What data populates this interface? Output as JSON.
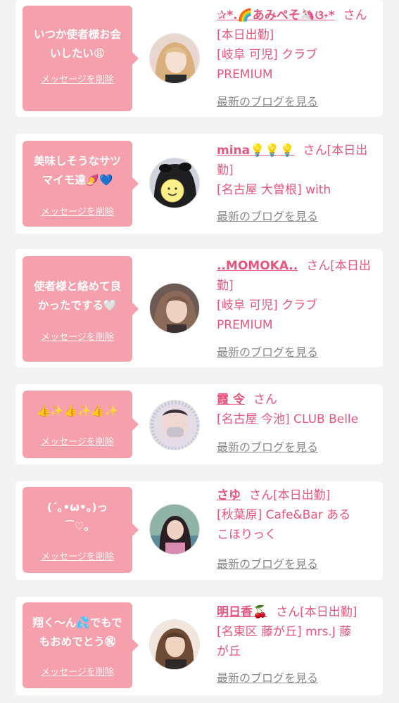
{
  "delete_label": "メッセージを削除",
  "blog_label": "最新のブログを見る",
  "colors": {
    "bubble": "#f7a0ad",
    "name": "#e8557e",
    "link_gray": "#8a8a8a",
    "background": "#f3f3f3"
  },
  "cards": [
    {
      "message": "いつか使者様お会\nいしたい😩",
      "avatar_icon": "cast-photo-1",
      "name": "✰*.🌈あみぺそ🦄ଓ˖*",
      "name_suffix": "さん[本日出勤]",
      "details": [
        "[岐阜 可児] クラブ",
        "PREMIUM"
      ]
    },
    {
      "message": "美味しそうなサツ\nマイモ達🍠💙",
      "avatar_icon": "cast-photo-2",
      "name": "mina💡💡💡",
      "name_suffix": "さん[本日出勤]",
      "details": [
        "[名古屋 大曽根] with"
      ]
    },
    {
      "message": "使者様と絡めて良\nかったでする🤍",
      "avatar_icon": "cast-photo-3",
      "name": "..MOMOKA..",
      "name_suffix": "さん[本日出勤]",
      "details": [
        "[岐阜 可児] クラブ",
        "PREMIUM"
      ]
    },
    {
      "message": "👍✨👍✨👍✨",
      "avatar_icon": "cast-photo-4",
      "name": "霞 令",
      "name_suffix": "さん",
      "details": [
        "[名古屋 今池] CLUB Belle"
      ]
    },
    {
      "message": "(´｡•ω•｡)っ\n⁀♡｡",
      "avatar_icon": "cast-photo-5",
      "name": "さゆ",
      "name_suffix": "さん[本日出勤]",
      "details": [
        "[秋葉原] Cafe&Bar ある",
        "こほりっく"
      ]
    },
    {
      "message": "翔く〜ん💦でもで\nもおめでとう㊗",
      "avatar_icon": "cast-photo-6",
      "name": "明日香🍒",
      "name_suffix": "さん[本日出勤]",
      "details": [
        "[名東区 藤が丘] mrs.J 藤",
        "が丘"
      ]
    }
  ]
}
